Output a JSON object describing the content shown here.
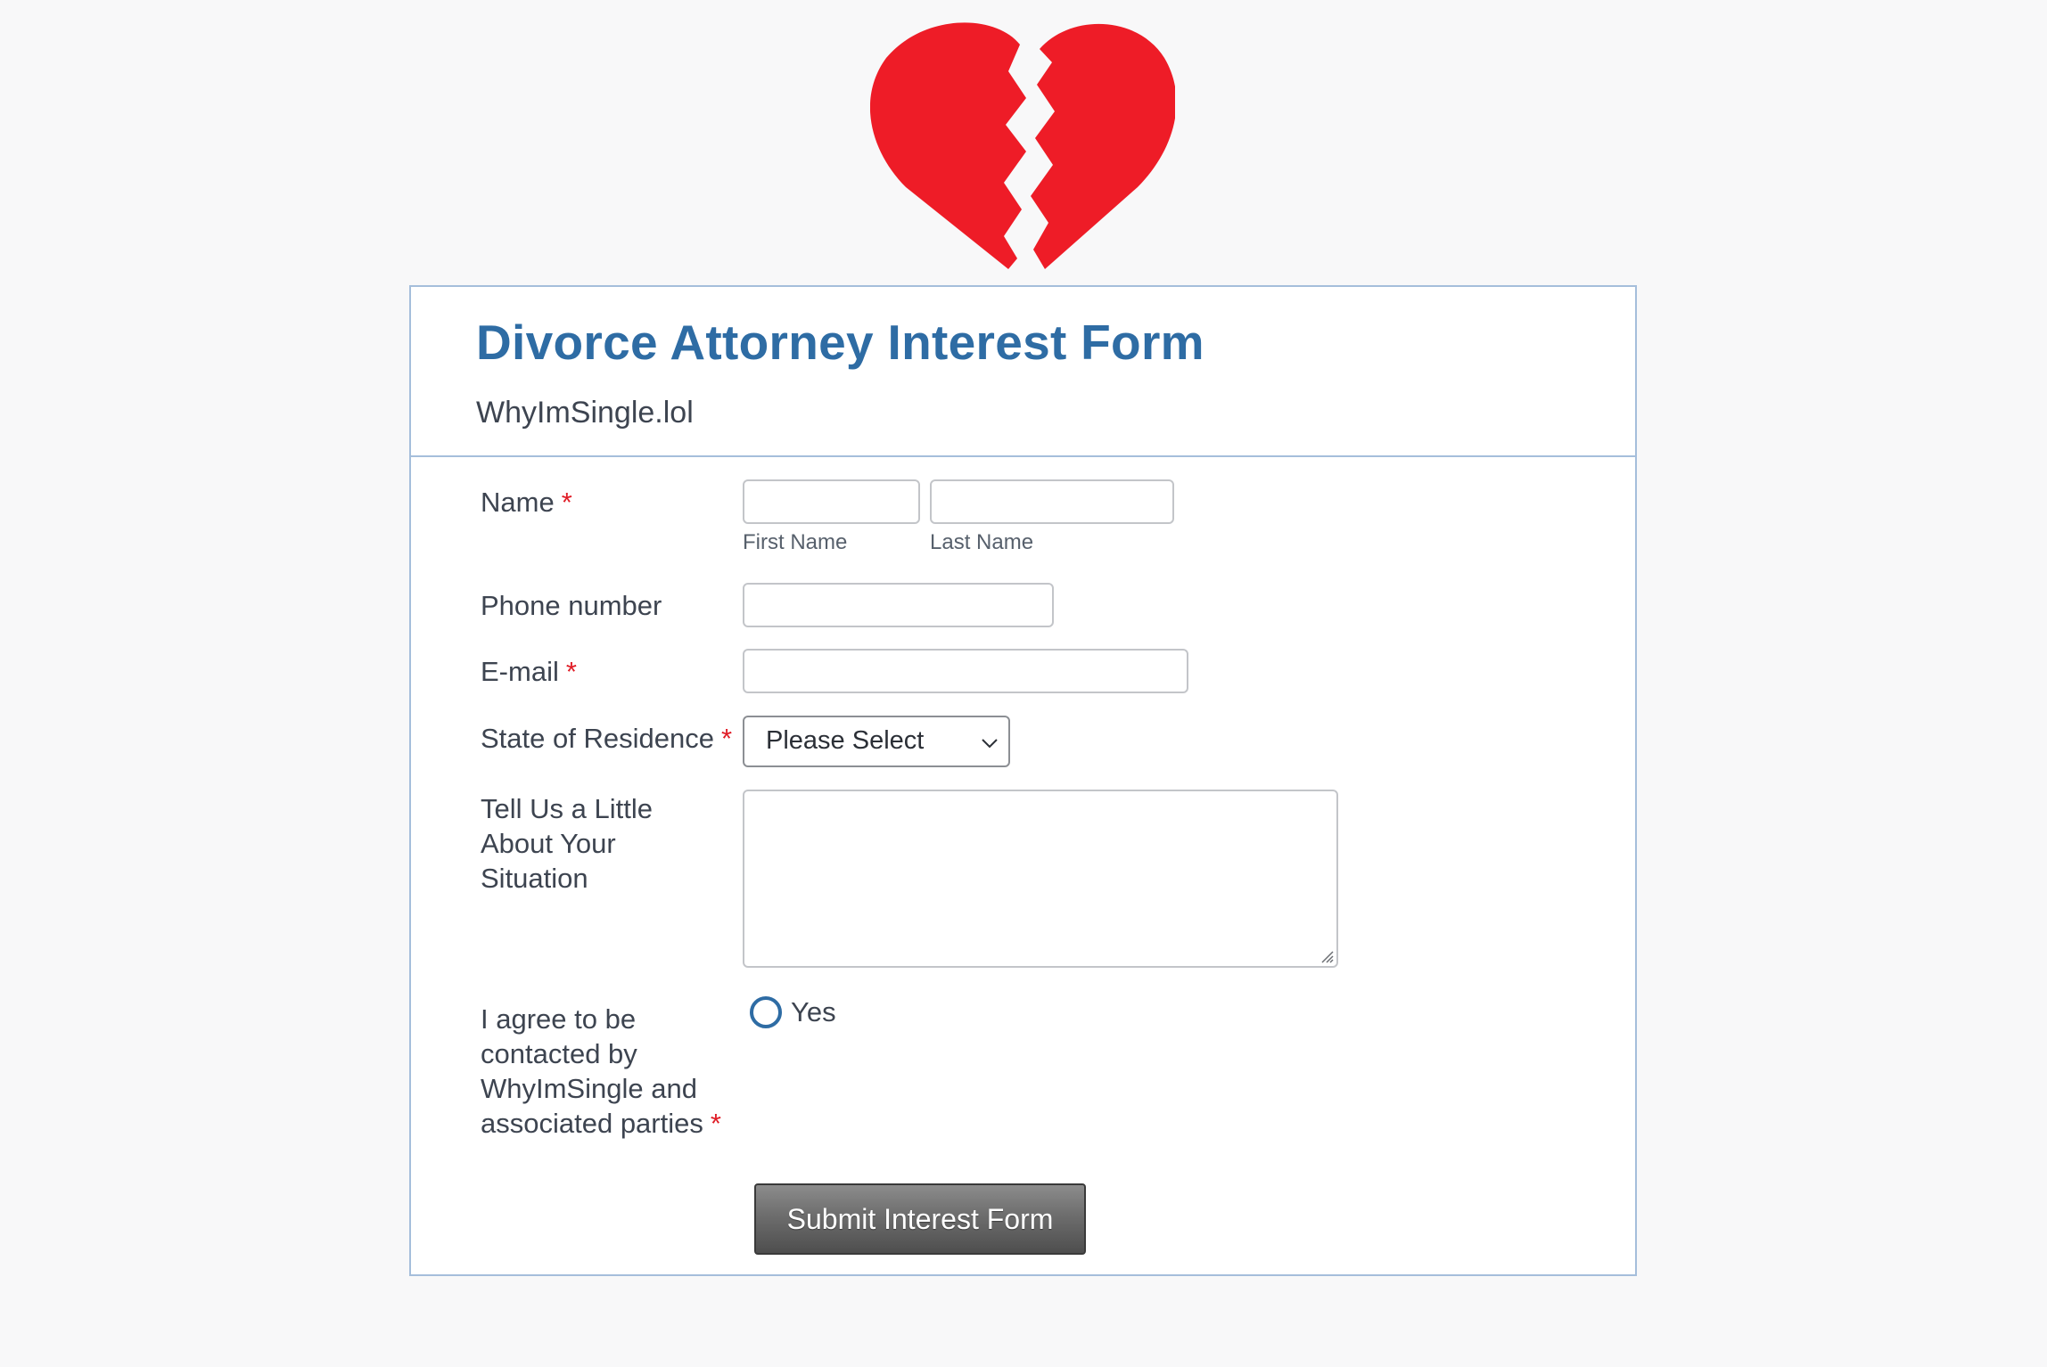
{
  "logo": {
    "icon": "broken-heart-icon",
    "color": "#ee1c27"
  },
  "header": {
    "title": "Divorce Attorney Interest Form",
    "subtitle": "WhyImSingle.lol"
  },
  "fields": {
    "name": {
      "label": "Name",
      "required_mark": "*",
      "first_sublabel": "First Name",
      "last_sublabel": "Last Name",
      "first_value": "",
      "last_value": ""
    },
    "phone": {
      "label": "Phone number",
      "value": ""
    },
    "email": {
      "label": "E-mail",
      "required_mark": "*",
      "value": ""
    },
    "state": {
      "label": "State of Residence",
      "required_mark": "*",
      "selected": "Please Select"
    },
    "situation": {
      "label_lines": [
        "Tell Us a Little",
        "About Your",
        "Situation"
      ],
      "value": ""
    },
    "consent": {
      "label_lines": [
        "I agree to be",
        "contacted by",
        "WhyImSingle and",
        "associated parties"
      ],
      "required_mark": "*",
      "option": "Yes",
      "checked": false
    }
  },
  "submit_label": "Submit Interest Form",
  "colors": {
    "accent": "#2e6ca4",
    "required": "#e01c26",
    "border": "#a5bedb",
    "background": "#f8f8f9"
  }
}
